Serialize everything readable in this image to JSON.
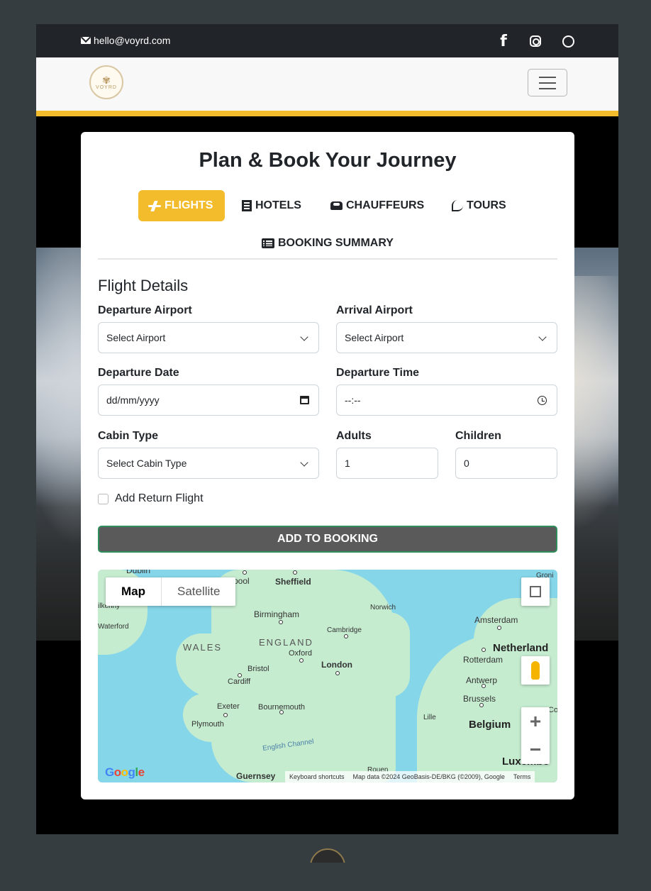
{
  "topbar": {
    "email": "hello@voyrd.com",
    "social": [
      {
        "icon": "facebook-icon",
        "label": "f"
      },
      {
        "icon": "instagram-icon"
      },
      {
        "icon": "whatsapp-icon"
      }
    ]
  },
  "navbar": {
    "logo_text": "VOYRD",
    "accent": "#f3bc2c"
  },
  "card": {
    "title": "Plan & Book Your Journey",
    "tabs": [
      {
        "label": "FLIGHTS",
        "icon": "plane-icon",
        "active": true
      },
      {
        "label": "HOTELS",
        "icon": "building-icon"
      },
      {
        "label": "CHAUFFEURS",
        "icon": "car-icon"
      },
      {
        "label": "TOURS",
        "icon": "route-icon"
      },
      {
        "label": "BOOKING SUMMARY",
        "icon": "list-icon"
      }
    ]
  },
  "form": {
    "section_title": "Flight Details",
    "departure_airport": {
      "label": "Departure Airport",
      "value": "Select Airport"
    },
    "arrival_airport": {
      "label": "Arrival Airport",
      "value": "Select Airport"
    },
    "departure_date": {
      "label": "Departure Date",
      "value": "dd/mm/yyyy"
    },
    "departure_time": {
      "label": "Departure Time",
      "value": "--:--"
    },
    "cabin_type": {
      "label": "Cabin Type",
      "value": "Select Cabin Type"
    },
    "adults": {
      "label": "Adults",
      "value": "1"
    },
    "children": {
      "label": "Children",
      "value": "0"
    },
    "return_flight": {
      "label": "Add Return Flight",
      "checked": false
    },
    "submit_label": "ADD TO BOOKING"
  },
  "map": {
    "map_type": [
      "Map",
      "Satellite"
    ],
    "selected_type": "Map",
    "zoom_in": "+",
    "zoom_out": "−",
    "google": "Google",
    "keyboard_shortcuts": "Keyboard shortcuts",
    "map_data": "Map data ©2024 GeoBasis-DE/BKG (©2009), Google",
    "terms": "Terms",
    "labels": {
      "dublin": "Dublin",
      "liverpool": "rpool",
      "sheffield": "Sheffield",
      "groningen": "Groni",
      "kilkenny": "ilkenny",
      "birmingham": "Birmingham",
      "norwich": "Norwich",
      "amsterdam": "Amsterdam",
      "waterford": "Waterford",
      "cambridge": "Cambridge",
      "wales": "WALES",
      "england": "ENGLAND",
      "netherlands": "Netherland",
      "oxford": "Oxford",
      "rotterdam": "Rotterdam",
      "bristol": "Bristol",
      "london": "London",
      "cardiff": "Cardiff",
      "antwerp": "Antwerp",
      "exeter": "Exeter",
      "bournemouth": "Bournemouth",
      "brussels": "Brussels",
      "cologne": "Co",
      "plymouth": "Plymouth",
      "lille": "Lille",
      "belgium": "Belgium",
      "english_channel": "English Channel",
      "guernsey": "Guernsey",
      "rouen": "Rouen",
      "luxembourg": "Luxembo"
    }
  }
}
